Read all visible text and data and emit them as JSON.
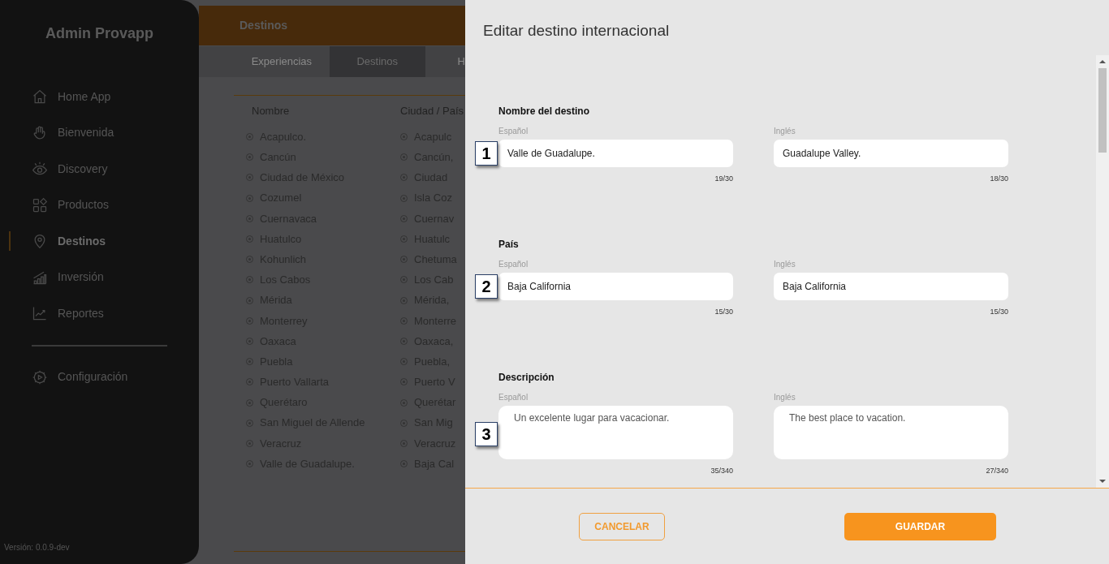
{
  "sidebar": {
    "title": "Admin Provapp",
    "items": [
      {
        "label": "Home App",
        "kind": "home",
        "selected": false
      },
      {
        "label": "Bienvenida",
        "kind": "wave",
        "selected": false
      },
      {
        "label": "Discovery",
        "kind": "eye",
        "selected": false
      },
      {
        "label": "Productos",
        "kind": "grid",
        "selected": false
      },
      {
        "label": "Destinos",
        "kind": "pin",
        "selected": true
      },
      {
        "label": "Inversión",
        "kind": "bars",
        "selected": false
      },
      {
        "label": "Reportes",
        "kind": "chart",
        "selected": false
      }
    ],
    "settings": {
      "label": "Configuración"
    },
    "version": "Versión: 0.0.9-dev"
  },
  "page": {
    "title": "Destinos",
    "tabs": [
      {
        "label": "Experiencias",
        "selected": false
      },
      {
        "label": "Destinos",
        "selected": true
      },
      {
        "label": "H",
        "selected": false
      }
    ],
    "columns": [
      "Nombre",
      "Ciudad / País"
    ],
    "rows": [
      [
        "Acapulco.",
        "Acapulc"
      ],
      [
        "Cancún",
        "Cancún,"
      ],
      [
        "Ciudad de México",
        "Ciudad"
      ],
      [
        "Cozumel",
        "Isla Coz"
      ],
      [
        "Cuernavaca",
        "Cuernav"
      ],
      [
        "Huatulco",
        "Huatulc"
      ],
      [
        "Kohunlich",
        "Chetuma"
      ],
      [
        "Los Cabos",
        "Los Cab"
      ],
      [
        "Mérida",
        "Mérida,"
      ],
      [
        "Monterrey",
        "Monterre"
      ],
      [
        "Oaxaca",
        "Oaxaca,"
      ],
      [
        "Puebla",
        "Puebla,"
      ],
      [
        "Puerto Vallarta",
        "Puerto V"
      ],
      [
        "Querétaro",
        "Querétar"
      ],
      [
        "San Miguel de Allende",
        "San Mig"
      ],
      [
        "Veracruz",
        "Veracruz"
      ],
      [
        "Valle de Guadalupe.",
        "Baja Cal"
      ]
    ]
  },
  "dialog": {
    "title": "Editar destino internacional",
    "sections": [
      {
        "title": "Nombre del destino",
        "kind": "input",
        "marker": "1",
        "fields": [
          {
            "label": "Español",
            "value": "Valle de Guadalupe.",
            "count": "19/30"
          },
          {
            "label": "Inglés",
            "value": "Guadalupe Valley.",
            "count": "18/30"
          }
        ]
      },
      {
        "title": "País",
        "kind": "input",
        "marker": "2",
        "fields": [
          {
            "label": "Español",
            "value": "Baja California",
            "count": "15/30"
          },
          {
            "label": "Inglés",
            "value": "Baja California",
            "count": "15/30"
          }
        ]
      },
      {
        "title": "Descripción",
        "kind": "textarea",
        "marker": "3",
        "fields": [
          {
            "label": "Español",
            "value": "Un excelente lugar para vacacionar.",
            "count": "35/340"
          },
          {
            "label": "Inglés",
            "value": "The best place to vacation.",
            "count": "27/340"
          }
        ]
      }
    ],
    "buttons": {
      "cancel": "CANCELAR",
      "save": "GUARDAR"
    }
  }
}
